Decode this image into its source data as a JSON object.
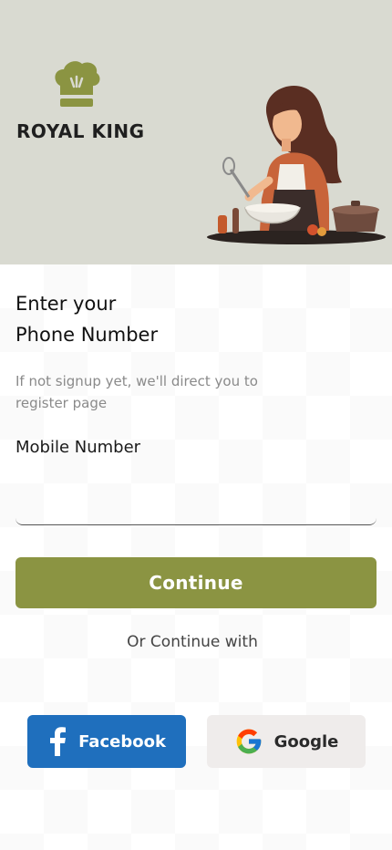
{
  "brand": {
    "name": "ROYAL KING"
  },
  "colors": {
    "hero_bg": "#d9dad1",
    "accent": "#8b9442",
    "facebook": "#1f6fbd",
    "google_bg": "#efeceb"
  },
  "login": {
    "heading_line1": "Enter your",
    "heading_line2": "Phone Number",
    "subtext": "If not signup yet, we'll direct you to register page",
    "mobile_label": "Mobile Number",
    "mobile_value": "",
    "continue_label": "Continue",
    "or_text": "Or Continue with"
  },
  "social": {
    "facebook_label": "Facebook",
    "google_label": "Google",
    "facebook_icon": "facebook-f-icon",
    "google_icon": "google-g-icon"
  }
}
